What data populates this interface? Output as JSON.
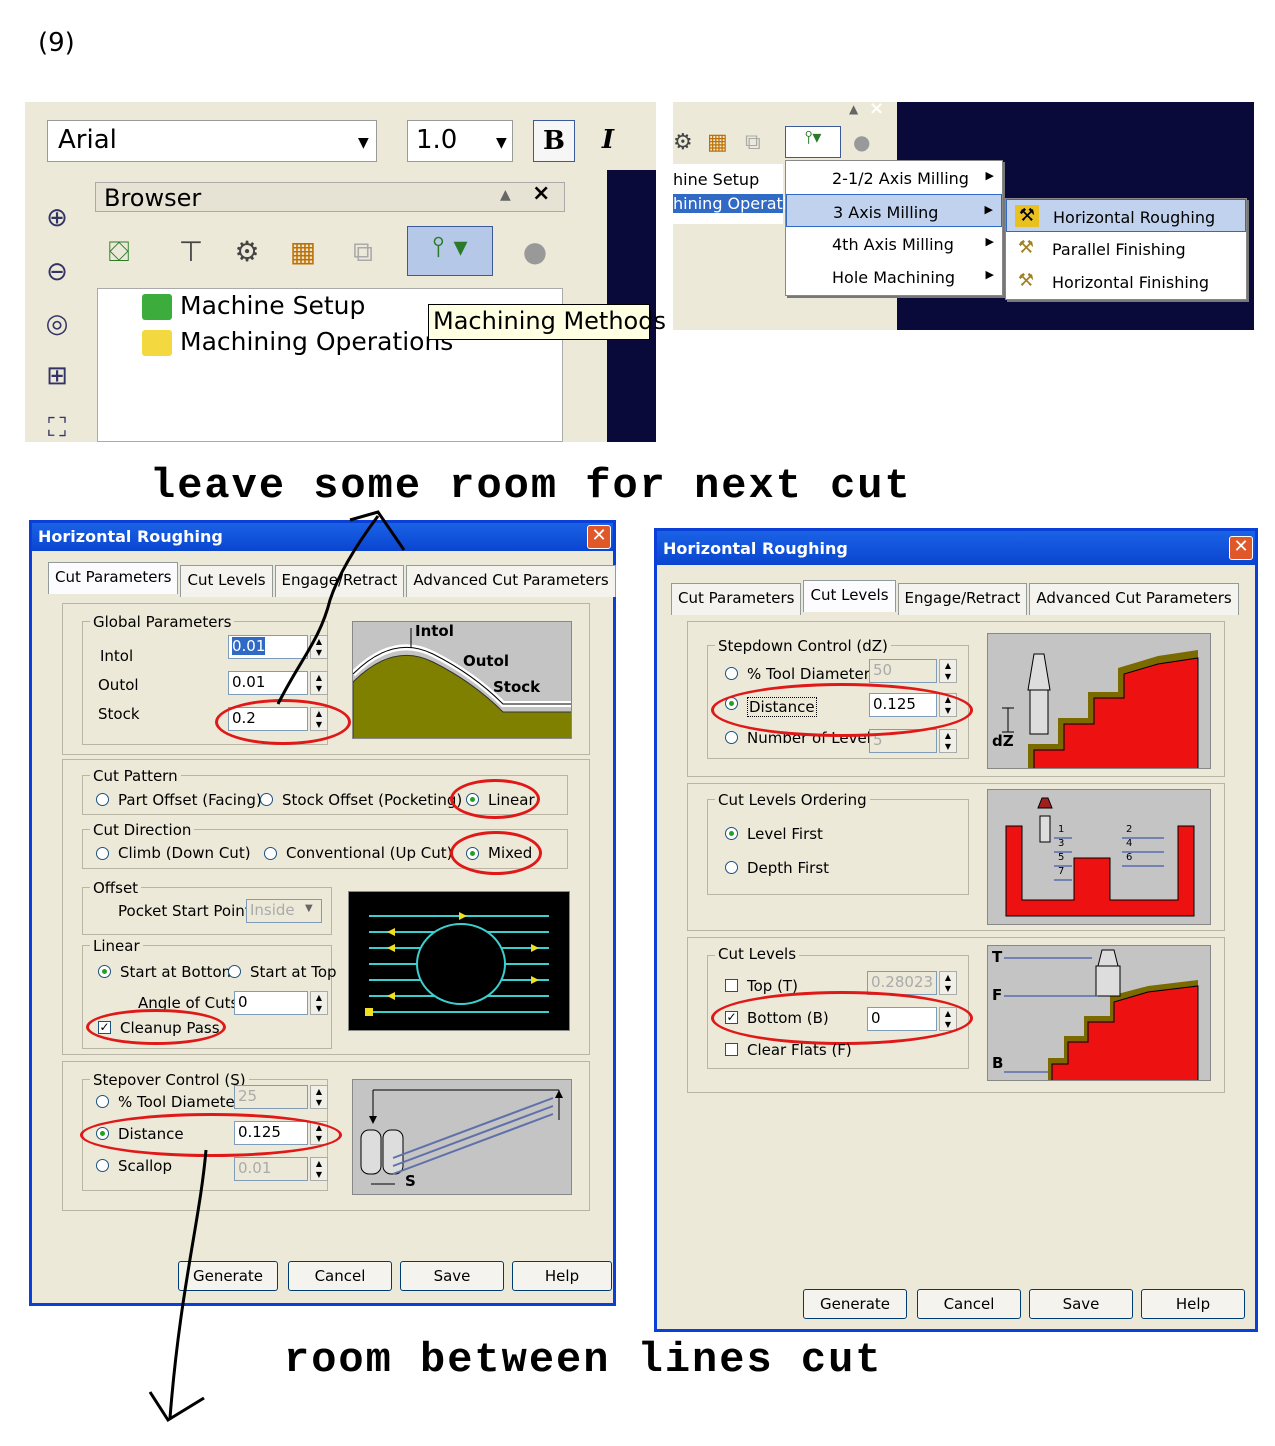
{
  "page_number": "(9)",
  "notes": {
    "top": "leave some room for next cut",
    "bottom": "room between lines cut"
  },
  "toolbar": {
    "font": "Arial",
    "size": "1.0",
    "bold": "B",
    "italic": "I"
  },
  "browser": {
    "title": "Browser",
    "tree": [
      "Machine Setup",
      "Machining Operations"
    ],
    "tooltip": "Machining Methods"
  },
  "menu_panel": {
    "tree": [
      "hine Setup",
      "hining Operation"
    ],
    "main_menu": [
      "2-1/2 Axis Milling",
      "3 Axis Milling",
      "4th Axis Milling",
      "Hole Machining"
    ],
    "sub_menu": [
      "Horizontal Roughing",
      "Parallel Finishing",
      "Horizontal Finishing"
    ]
  },
  "dialog_left": {
    "title": "Horizontal Roughing",
    "tabs": [
      "Cut Parameters",
      "Cut Levels",
      "Engage/Retract",
      "Advanced Cut Parameters"
    ],
    "global": {
      "label": "Global Parameters",
      "intol_label": "Intol",
      "intol_value": "0.01",
      "outol_label": "Outol",
      "outol_value": "0.01",
      "stock_label": "Stock",
      "stock_value": "0.2",
      "pic_labels": [
        "Intol",
        "Outol",
        "Stock"
      ]
    },
    "cut_pattern": {
      "label": "Cut Pattern",
      "options": [
        "Part Offset (Facing)",
        "Stock Offset (Pocketing)",
        "Linear"
      ],
      "selected": "Linear"
    },
    "cut_direction": {
      "label": "Cut Direction",
      "options": [
        "Climb (Down Cut)",
        "Conventional (Up Cut)",
        "Mixed"
      ],
      "selected": "Mixed"
    },
    "offset": {
      "label": "Offset",
      "pocket_label": "Pocket Start Point",
      "pocket_value": "Inside"
    },
    "linear": {
      "label": "Linear",
      "start_bottom": "Start at Bottom",
      "start_top": "Start at Top",
      "angle_label": "Angle of Cuts",
      "angle_value": "0",
      "cleanup": "Cleanup Pass"
    },
    "stepover": {
      "label": "Stepover Control (S)",
      "tool_dia": "% Tool Diameter",
      "tool_dia_value": "25",
      "distance": "Distance",
      "distance_value": "0.125",
      "scallop": "Scallop",
      "scallop_value": "0.01",
      "pic_label": "S"
    },
    "buttons": [
      "Generate",
      "Cancel",
      "Save",
      "Help"
    ]
  },
  "dialog_right": {
    "title": "Horizontal Roughing",
    "tabs": [
      "Cut Parameters",
      "Cut Levels",
      "Engage/Retract",
      "Advanced Cut Parameters"
    ],
    "stepdown": {
      "label": "Stepdown Control (dZ)",
      "tool_dia": "% Tool Diameter",
      "tool_dia_value": "50",
      "distance": "Distance",
      "distance_value": "0.125",
      "levels": "Number of Levels",
      "levels_value": "5",
      "pic_label": "dZ"
    },
    "ordering": {
      "label": "Cut Levels Ordering",
      "level_first": "Level First",
      "depth_first": "Depth First",
      "pic_numbers_left": [
        "1",
        "3",
        "5",
        "7"
      ],
      "pic_numbers_right": [
        "2",
        "4",
        "6"
      ]
    },
    "cut_levels": {
      "label": "Cut Levels",
      "top": "Top (T)",
      "top_value": "0.28023",
      "bottom": "Bottom (B)",
      "bottom_value": "0",
      "clear": "Clear Flats (F)",
      "pic_labels": [
        "T",
        "F",
        "B"
      ]
    },
    "buttons": [
      "Generate",
      "Cancel",
      "Save",
      "Help"
    ]
  }
}
